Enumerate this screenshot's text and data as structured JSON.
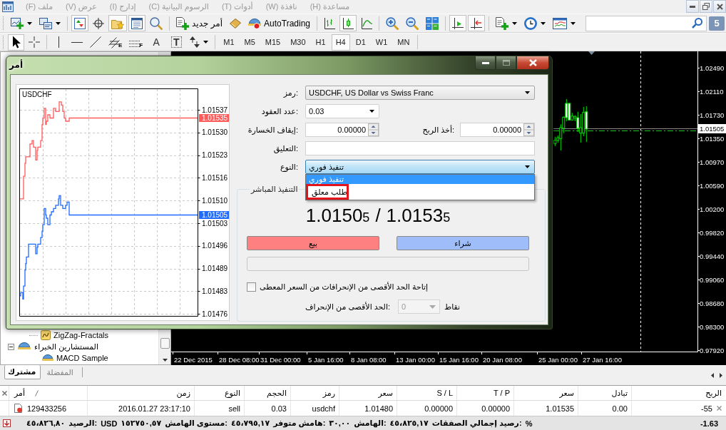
{
  "menu_bar": {
    "items": [
      {
        "label": "مساعدة (H)",
        "disabled": true
      },
      {
        "label": "نافذة (W)",
        "disabled": true
      },
      {
        "label": "أدوات (T)",
        "disabled": true
      },
      {
        "label": "الرسوم البيانية (C)",
        "disabled": true
      },
      {
        "label": "إدارج (I)",
        "disabled": true
      },
      {
        "label": "عرض (V)",
        "disabled": true
      },
      {
        "label": "ملف (F)",
        "disabled": true
      }
    ]
  },
  "toolbar": {
    "items": [
      {
        "kind": "menu-button",
        "on": false
      },
      {
        "kind": "menu-button",
        "on": false
      },
      {
        "kind": "menu-button",
        "on": false
      },
      {
        "kind": "separator"
      },
      {
        "kind": "icon-button",
        "on": true
      },
      {
        "kind": "icon-button",
        "on": true
      },
      {
        "kind": "separator"
      },
      {
        "kind": "icon-button",
        "on": false
      },
      {
        "kind": "icon-button",
        "on": false
      },
      {
        "kind": "icon-button",
        "on": false
      },
      {
        "kind": "separator"
      },
      {
        "kind": "icon-button",
        "on": false
      },
      {
        "kind": "icon-button",
        "on": true
      },
      {
        "kind": "icon-button",
        "on": false
      },
      {
        "kind": "separator"
      },
      {
        "kind": "text-button",
        "label": "AutoTrading",
        "on": false
      },
      {
        "kind": "icon-button",
        "on": false
      },
      {
        "kind": "text-button",
        "label": "أمر جديد",
        "on": false
      },
      {
        "kind": "separator"
      },
      {
        "kind": "icon-button",
        "on": false
      },
      {
        "kind": "icon-button",
        "on": true
      },
      {
        "kind": "icon-button",
        "on": true
      },
      {
        "kind": "icon-button",
        "on": false
      },
      {
        "kind": "icon-button",
        "on": true
      },
      {
        "kind": "separator"
      },
      {
        "kind": "menu-button",
        "on": false
      },
      {
        "kind": "menu-button",
        "on": false
      }
    ],
    "messages_badge": "5"
  },
  "drawing_toolbar": {
    "items": [
      {
        "kind": "menu-button",
        "on": false
      },
      {
        "kind": "framed-glyph-button",
        "glyph": "T",
        "on": false
      },
      {
        "kind": "glyph-button",
        "glyph": "A",
        "on": false
      },
      {
        "kind": "letter-button",
        "letter": "F",
        "on": false
      },
      {
        "kind": "letter-button",
        "letter": "E",
        "on": false
      },
      {
        "kind": "icon-button",
        "on": false
      },
      {
        "kind": "icon-button",
        "on": false
      },
      {
        "kind": "icon-button",
        "on": false
      },
      {
        "kind": "separator"
      },
      {
        "kind": "icon-button",
        "on": false
      },
      {
        "kind": "icon-button",
        "on": true
      }
    ],
    "timeframes": [
      {
        "label": "MN",
        "selected": false
      },
      {
        "label": "W1",
        "selected": false
      },
      {
        "label": "D1",
        "selected": false
      },
      {
        "label": "H4",
        "selected": true
      },
      {
        "label": "H1",
        "selected": false
      },
      {
        "label": "M30",
        "selected": false
      },
      {
        "label": "M15",
        "selected": false
      },
      {
        "label": "M5",
        "selected": false
      },
      {
        "label": "M1",
        "selected": false
      }
    ]
  },
  "navigator": {
    "items": [
      {
        "kind": "indicator",
        "label": "ZigZag-Fractals"
      },
      {
        "kind": "folder",
        "label": "المستشارين الخبراء",
        "expanded": true,
        "children": [
          {
            "kind": "expert",
            "label": "MACD Sample"
          }
        ]
      }
    ],
    "tabs": [
      {
        "label": "المفضلة",
        "selected": false
      },
      {
        "label": "مشترك",
        "selected": true
      }
    ]
  },
  "chart": {
    "price_labels": [
      "1.02490",
      "1.02110",
      "1.01730",
      "1.01350",
      "1.00970",
      "1.00590",
      "1.00200",
      "0.99820",
      "0.99440",
      "0.99060",
      "0.98680",
      "0.98300",
      "0.97920"
    ],
    "current_price": "1.01505",
    "time_labels": [
      "27 Jan 16:00",
      "25 Jan 00:00",
      "20 Jan 08:00",
      "15 Jan 16:00",
      "13 Jan 00:00",
      "8 Jan 08:00",
      "5 Jan 16:00",
      "31 Dec 00:00",
      "28 Dec 08:00",
      "22 Dec 2015"
    ]
  },
  "order_dialog": {
    "title": "أمر",
    "maximize_disabled": true,
    "tick_chart": {
      "symbol": "USDCHF",
      "price_labels": [
        "1.01537",
        "1.01530",
        "1.01523",
        "1.01516",
        "1.01510",
        "1.01503",
        "1.01496",
        "1.01489",
        "1.01483",
        "1.01476"
      ],
      "ask_price": "1.01535",
      "bid_price": "1.01505"
    },
    "symbol": {
      "label": "رمز:",
      "value": "USDCHF, US Dollar vs Swiss Franc"
    },
    "volume": {
      "label": "عدد العقود:",
      "value": "0.03"
    },
    "stop_loss": {
      "label": "إيقاف الخسارة:",
      "value": "0.00000"
    },
    "take_profit": {
      "label": "أخذ الربح:",
      "value": "0.00000"
    },
    "comment": {
      "label": "التعليق:"
    },
    "type": {
      "label": "النوع:",
      "value": "تنفيذ فوري",
      "expanded": true,
      "options": [
        {
          "label": "تنفيذ فوري",
          "selected": true,
          "highlighted": false
        },
        {
          "label": "طلب معلق",
          "selected": false,
          "highlighted": true
        }
      ]
    },
    "execution": {
      "title": "التنفيذ المباشر",
      "bid": "1.0150",
      "bid_pip": "5",
      "separator": "/",
      "ask": "1.0153",
      "ask_pip": "5",
      "sell_button": "بيع",
      "buy_button": "شراء",
      "deviation_checkbox": {
        "label": "إتاحة الحد الأقصى من الإنحرافات من السعر المعطى",
        "checked": false
      },
      "max_deviation": {
        "label": "الحد الأقصى من الإنحراف:",
        "value": "0",
        "unit": "نقاط",
        "disabled": true
      }
    }
  },
  "terminal": {
    "columns": [
      "الربح",
      "تبادل",
      "سعر",
      "T / P",
      "S / L",
      "سعر",
      "رمز",
      "الحجم",
      "النوع",
      "زمن",
      "أمر"
    ],
    "rows": [
      {
        "cells": [
          "-55",
          "0.00",
          "1.01535",
          "0.00000",
          "0.00000",
          "1.01480",
          "usdchf",
          "0.03",
          "sell",
          "2016.01.27 23:17:10",
          "129433256"
        ]
      }
    ],
    "summary": {
      "segments": [
        "%",
        "رصيد إجمالي الصفقات:",
        "٤٥،٨٢٥,١٧",
        "الهامش:",
        "٣٠,٠٠",
        "هامش متوفر:",
        "٤٥،٧٩٥,١٧",
        "مستوى الهامش:",
        "١٥٢٧٥٠,٥٧",
        "USD",
        "الرصيد:",
        "٤٥،٨٢٦,٨٠"
      ],
      "profit": "-1.63"
    }
  }
}
